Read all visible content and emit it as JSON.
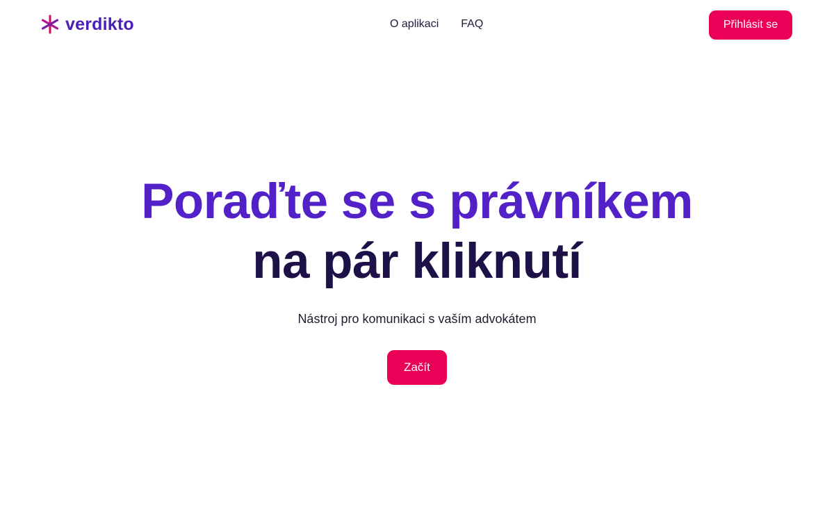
{
  "header": {
    "logo": {
      "icon": "asterisk-logo-icon",
      "text": "verdikto"
    },
    "nav": [
      {
        "label": "O aplikaci"
      },
      {
        "label": "FAQ"
      }
    ],
    "login_label": "Přihlásit se"
  },
  "hero": {
    "title_line1": "Poraďte se s právníkem",
    "title_line2": "na pár kliknutí",
    "subtitle": "Nástroj pro komunikaci s vaším advokátem",
    "cta_label": "Začít"
  },
  "colors": {
    "brand_purple": "#5222c8",
    "dark_navy": "#1e1147",
    "accent_pink": "#ea0056",
    "background": "#ffffff"
  }
}
